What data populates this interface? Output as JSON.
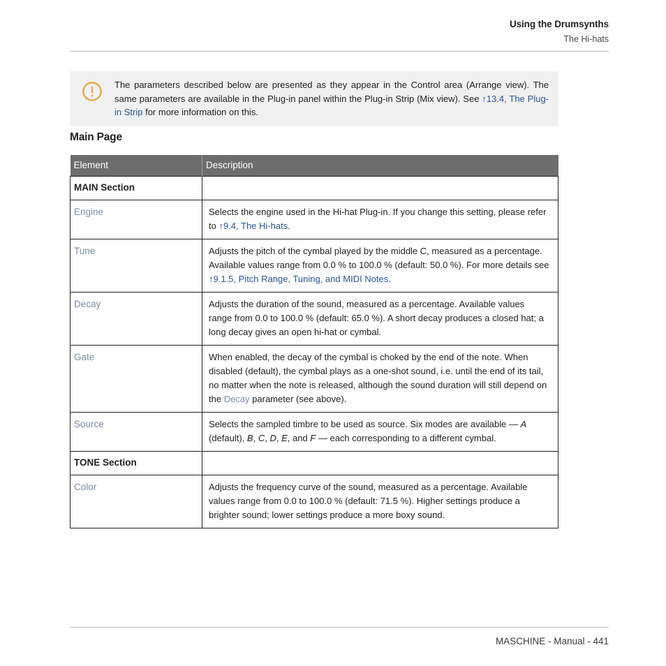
{
  "header": {
    "chapter": "Using the Drumsynths",
    "section": "The Hi-hats"
  },
  "note": {
    "icon": "exclamation-circle-icon",
    "icon_color": "#e3a84c",
    "background": "#f0f0f0",
    "text_part_1": "The parameters described below are presented as they appear in the Control area (Arrange view). The same parameters are available in the Plug-in panel within the Plug-in Strip (Mix view). See ",
    "link": "↑13.4, The Plug-in Strip",
    "text_part_2": " for more information on this."
  },
  "section_heading": "Main Page",
  "table": {
    "header_background": "#6d6d6d",
    "columns": [
      "Element",
      "Description"
    ],
    "rows": [
      {
        "type": "section",
        "element": "MAIN Section",
        "description": ""
      },
      {
        "type": "param",
        "element": "Engine",
        "desc_part_1": "Selects the engine used in the Hi-hat Plug-in. If you change this setting, please refer to ",
        "desc_link": "↑9.4, The Hi-hats",
        "desc_part_2": "."
      },
      {
        "type": "param",
        "element": "Tune",
        "desc_part_1": "Adjusts the pitch of the cymbal played by the middle C, measured as a percentage. Available values range from 0.0 % to 100.0 % (default: 50.0 %). For more details see ",
        "desc_link": "↑9.1.5, Pitch Range, Tuning, and MIDI Notes",
        "desc_part_2": "."
      },
      {
        "type": "param",
        "element": "Decay",
        "desc_part_1": "Adjusts the duration of the sound, measured as a percentage. Available values range from 0.0 to 100.0 % (default: 65.0 %). A short decay produces a closed hat; a long decay gives an open hi-hat or cymbal.",
        "desc_link": "",
        "desc_part_2": ""
      },
      {
        "type": "param-ref",
        "element": "Gate",
        "desc_part_1": "When enabled, the decay of the cymbal is choked by the end of the note. When disabled (default), the cymbal plays as a one-shot sound, i.e. until the end of its tail, no matter when the note is released, although the sound duration will still depend on the ",
        "desc_ref": "Decay",
        "desc_part_2": " parameter (see above)."
      },
      {
        "type": "param-italic",
        "element": "Source",
        "desc_part_1": "Selects the sampled timbre to be used as source. Six modes are available — ",
        "italic_1": "A",
        "desc_mid_1": " (default), ",
        "italic_2": "B",
        "desc_mid_2": ", ",
        "italic_3": "C",
        "desc_mid_3": ", ",
        "italic_4": "D",
        "desc_mid_4": ", ",
        "italic_5": "E",
        "desc_mid_5": ", and ",
        "italic_6": "F",
        "desc_part_2": " — each corresponding to a different cymbal."
      },
      {
        "type": "section",
        "element": "TONE Section",
        "description": ""
      },
      {
        "type": "param",
        "element": "Color",
        "desc_part_1": "Adjusts the frequency curve of the sound, measured as a percentage. Available values range from 0.0 to 100.0 % (default: 71.5 %). Higher settings produce a brighter sound; lower settings produce a more boxy sound.",
        "desc_link": "",
        "desc_part_2": ""
      }
    ]
  },
  "footer": {
    "text": "MASCHINE - Manual - 441"
  },
  "colors": {
    "link": "#2d5591",
    "param_name": "#7d8ca3",
    "table_header_bg": "#6d6d6d",
    "note_bg": "#f0f0f0",
    "icon_gold": "#e3a84c",
    "rule": "#b8b8b8"
  }
}
